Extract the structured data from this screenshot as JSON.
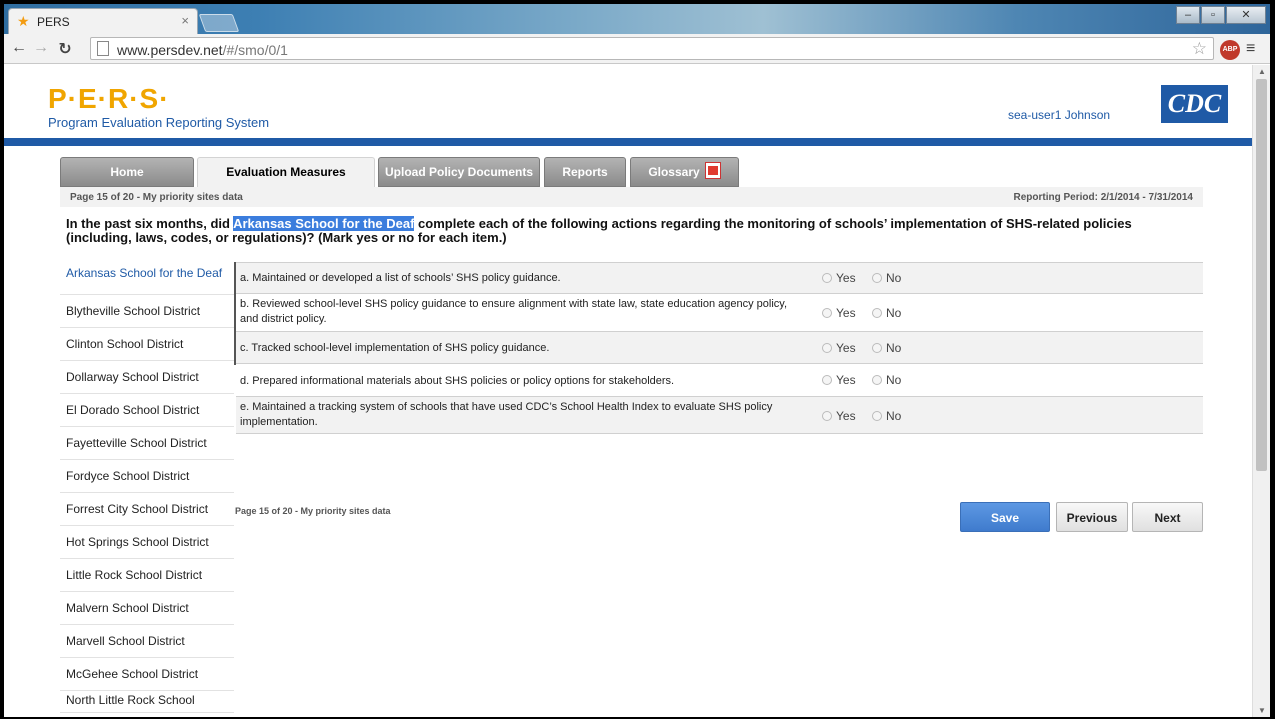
{
  "browser": {
    "tab_title": "PERS",
    "tab_close": "×",
    "url_host": "www.persdev.net",
    "url_path": "/#/smo/0/1",
    "abp_label": "ABP",
    "window_controls": {
      "minimize": "–",
      "maximize": "▫",
      "close": "✕"
    }
  },
  "header": {
    "logo_text": "P·E·R·S·",
    "logo_subtitle": "Program Evaluation Reporting System",
    "user_name": "sea-user1 Johnson",
    "agency_logo": "CDC"
  },
  "nav": {
    "tabs": [
      {
        "label": "Home"
      },
      {
        "label": "Evaluation Measures Reporting"
      },
      {
        "label": "Upload Policy Documents"
      },
      {
        "label": "Reports"
      },
      {
        "label": "Glossary"
      }
    ]
  },
  "page": {
    "page_info": "Page 15 of 20 - My priority sites data",
    "reporting_period": "Reporting Period: 2/1/2014 - 7/31/2014",
    "question_prefix": "In the past six months, did ",
    "question_entity": "Arkansas School for the Deaf",
    "question_suffix": " complete each of the following actions regarding the monitoring of schools’ implementation of SHS-related policies (including, laws, codes, or regulations)? (Mark yes or no for each item.)",
    "footer_page_info": "Page 15 of 20 - My priority sites data"
  },
  "schools": [
    "Arkansas School for the Deaf",
    "Blytheville School District",
    "Clinton School District",
    "Dollarway School District",
    "El Dorado School District",
    "Fayetteville School District",
    "Fordyce School District",
    "Forrest City School District",
    "Hot Springs School District",
    "Little Rock School District",
    "Malvern School District",
    "Marvell School District",
    "McGehee School District",
    "North Little Rock School"
  ],
  "items": [
    {
      "text": "a. Maintained or developed a list of schools’ SHS policy guidance."
    },
    {
      "text": "b. Reviewed school-level SHS policy guidance to ensure alignment with state law, state education agency policy, and district policy."
    },
    {
      "text": "c. Tracked school-level implementation of SHS policy guidance."
    },
    {
      "text": "d. Prepared informational materials about SHS policies or policy options for stakeholders."
    },
    {
      "text": "e. Maintained a tracking system of schools that have used CDC’s School Health Index to evaluate SHS policy implementation."
    }
  ],
  "answer_labels": {
    "yes": "Yes",
    "no": "No"
  },
  "buttons": {
    "save": "Save",
    "previous": "Previous",
    "next": "Next"
  },
  "colors": {
    "brand_blue": "#1f5aa6",
    "logo_orange": "#f0a500",
    "save_blue": "#4a87d8"
  }
}
